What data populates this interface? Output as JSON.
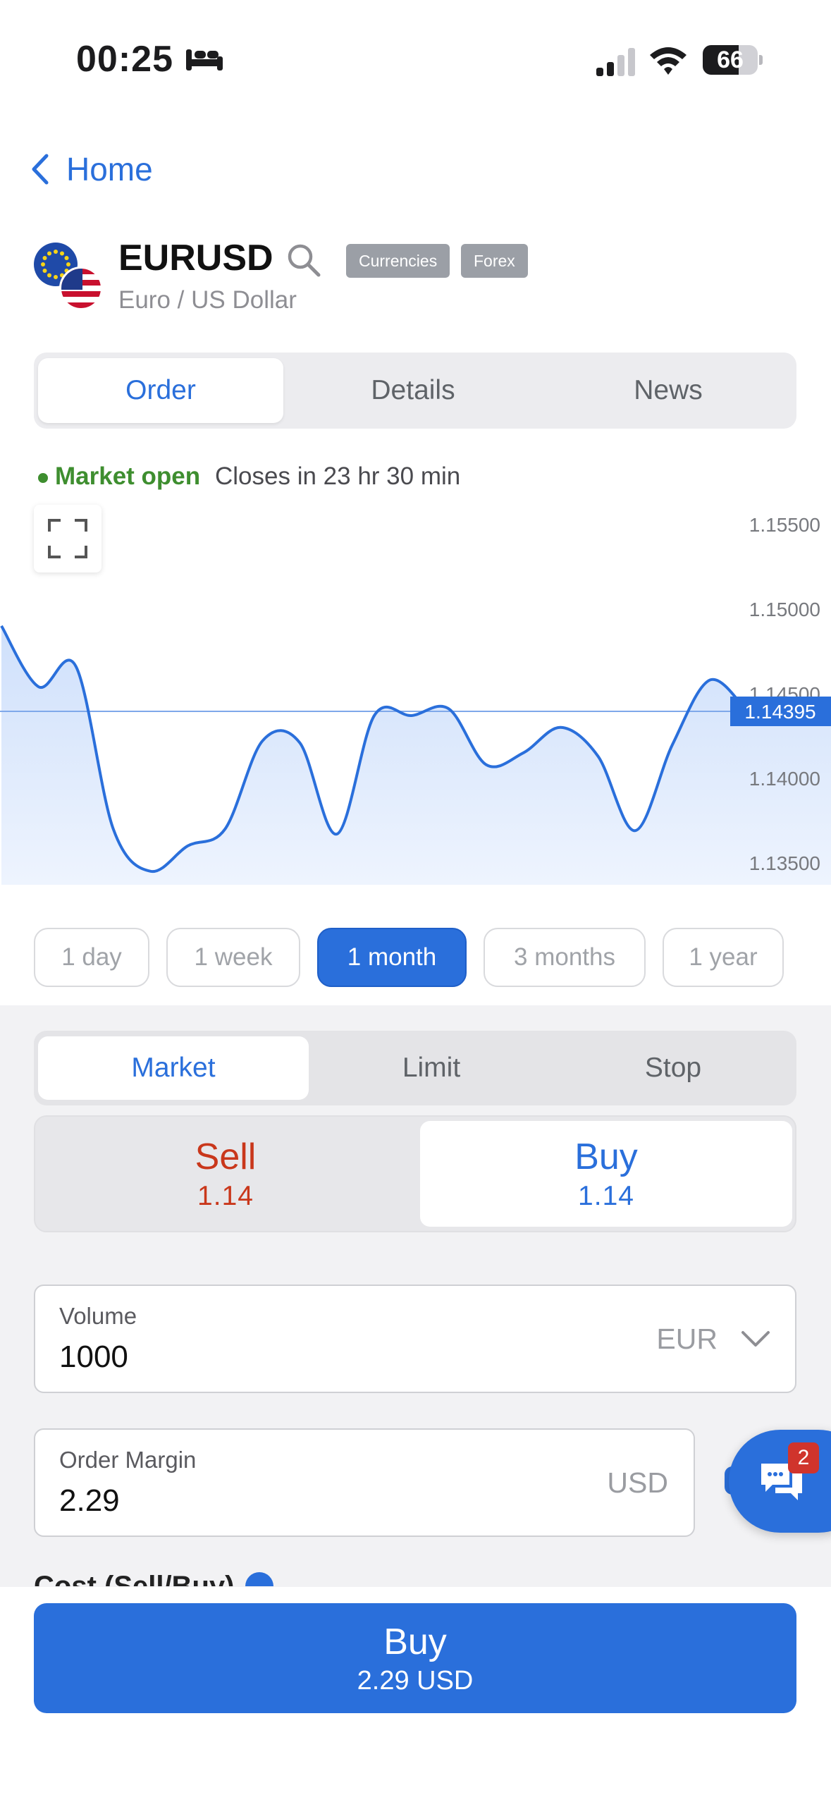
{
  "status_bar": {
    "time": "00:25",
    "battery": "66",
    "battery_level": 0.66
  },
  "nav": {
    "back_label": "Home"
  },
  "instrument": {
    "symbol": "EURUSD",
    "name": "Euro / US Dollar",
    "tags": [
      "Currencies",
      "Forex"
    ]
  },
  "tabs": [
    "Order",
    "Details",
    "News"
  ],
  "active_tab": "Order",
  "market": {
    "status": "Market open",
    "closes": "Closes in 23 hr 30 min"
  },
  "chart_data": {
    "type": "area",
    "title": "",
    "x": [
      0,
      1,
      2,
      3,
      4,
      5,
      6,
      7,
      8,
      9,
      10,
      11,
      12,
      13,
      14,
      15,
      16,
      17,
      18,
      19,
      20
    ],
    "values": [
      1.149,
      1.1454,
      1.1466,
      1.137,
      1.1345,
      1.136,
      1.137,
      1.1422,
      1.1421,
      1.1367,
      1.1437,
      1.1437,
      1.1441,
      1.1408,
      1.1415,
      1.143,
      1.1413,
      1.1369,
      1.142,
      1.1458,
      1.14395
    ],
    "y_ticks": [
      "1.15500",
      "1.15000",
      "1.14500",
      "1.14000",
      "1.13500"
    ],
    "y_tick_values": [
      1.155,
      1.15,
      1.145,
      1.14,
      1.135
    ],
    "ylim": [
      1.1337,
      1.1562
    ],
    "current_price": 1.14395,
    "current_price_label": "1.14395",
    "colors": {
      "line": "#2a6fdb",
      "fill_top": "#cfe0fb",
      "fill_bottom": "#eef4fe"
    }
  },
  "ranges": [
    "1 day",
    "1 week",
    "1 month",
    "3 months",
    "1 year"
  ],
  "active_range": "1 month",
  "order_types": [
    "Market",
    "Limit",
    "Stop"
  ],
  "active_order_type": "Market",
  "sides": {
    "sell": {
      "label": "Sell",
      "price": "1.14"
    },
    "buy": {
      "label": "Buy",
      "price": "1.14"
    },
    "active": "buy"
  },
  "volume": {
    "label": "Volume",
    "value": "1000",
    "unit": "EUR"
  },
  "margin": {
    "label": "Order Margin",
    "value": "2.29",
    "unit": "USD"
  },
  "cost_label": "Cost (Sell/Buy)",
  "chat": {
    "badge": "2"
  },
  "buy_button": {
    "label": "Buy",
    "amount": "2.29 USD"
  },
  "colors": {
    "accent": "#2a6fdb",
    "sell": "#c9371b",
    "market_open": "#3e8e2f"
  }
}
